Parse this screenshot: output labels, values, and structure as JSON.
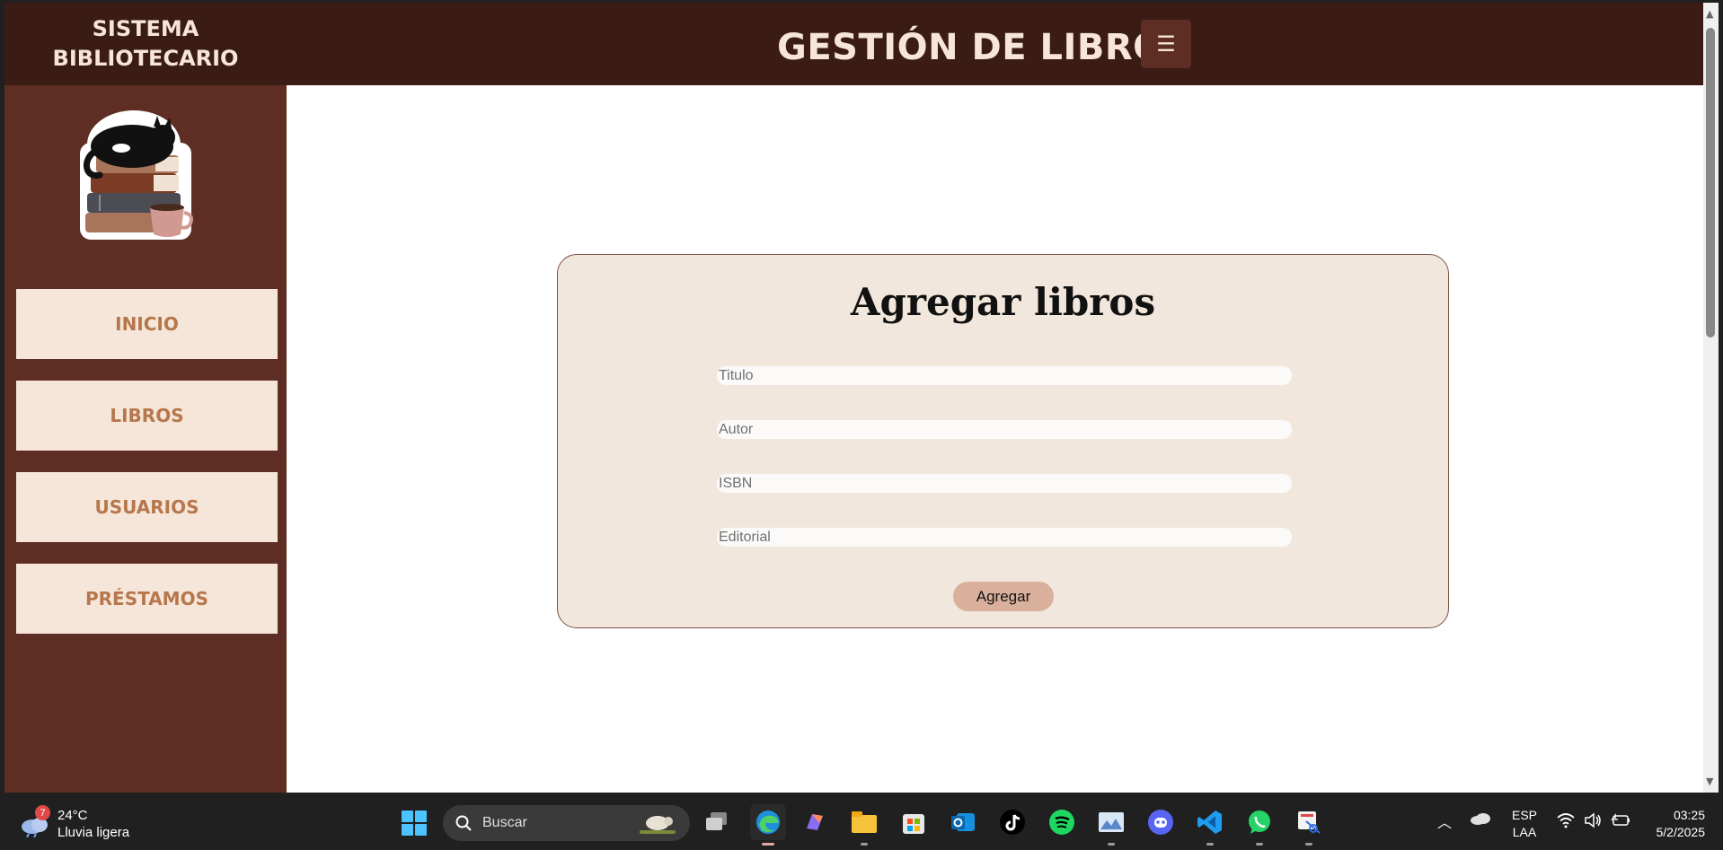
{
  "app": {
    "brand_line1": "SISTEMA",
    "brand_line2": "BIBLIOTECARIO",
    "page_heading": "GESTIÓN DE LIBROS",
    "menu_button": "☰"
  },
  "sidebar": {
    "items": [
      {
        "label": "INICIO"
      },
      {
        "label": "LIBROS"
      },
      {
        "label": "USUARIOS"
      },
      {
        "label": "PRÉSTAMOS"
      }
    ]
  },
  "form": {
    "title": "Agregar libros",
    "fields": [
      {
        "placeholder": "Titulo",
        "value": ""
      },
      {
        "placeholder": "Autor",
        "value": ""
      },
      {
        "placeholder": "ISBN",
        "value": ""
      },
      {
        "placeholder": "Editorial",
        "value": ""
      }
    ],
    "submit_label": "Agregar"
  },
  "colors": {
    "header_bg": "#3a1c15",
    "sidebar_bg": "#5e2e24",
    "nav_item_bg": "#f6e6d9",
    "nav_text": "#b6774c",
    "card_bg": "#f2e7dd",
    "button_bg": "#d9b09c"
  },
  "taskbar": {
    "weather": {
      "temp": "24°C",
      "condition": "Lluvia ligera",
      "badge": "7",
      "icon": "cloud-rain-icon"
    },
    "search_label": "Buscar",
    "apps": [
      {
        "name": "task-view"
      },
      {
        "name": "edge"
      },
      {
        "name": "copilot"
      },
      {
        "name": "file-explorer"
      },
      {
        "name": "microsoft-store"
      },
      {
        "name": "outlook"
      },
      {
        "name": "tiktok"
      },
      {
        "name": "spotify"
      },
      {
        "name": "photos"
      },
      {
        "name": "discord"
      },
      {
        "name": "vscode"
      },
      {
        "name": "whatsapp"
      },
      {
        "name": "snipping-tool"
      }
    ],
    "language": {
      "line1": "ESP",
      "line2": "LAA"
    },
    "clock": {
      "time": "03:25",
      "date": "5/2/2025"
    }
  }
}
